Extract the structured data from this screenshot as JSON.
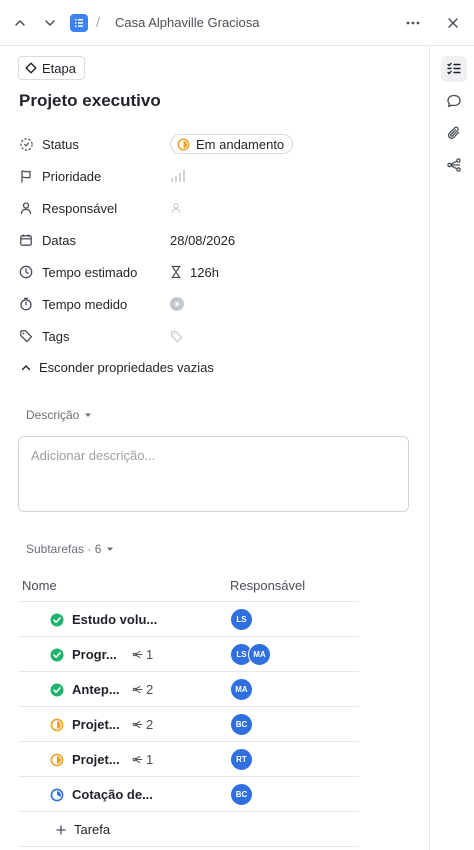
{
  "header": {
    "breadcrumb": "Casa Alphaville Graciosa",
    "separator": "/"
  },
  "task": {
    "type_badge": "Etapa",
    "title": "Projeto executivo"
  },
  "properties": [
    {
      "label": "Status",
      "value": "Em andamento"
    },
    {
      "label": "Prioridade",
      "value": ""
    },
    {
      "label": "Responsável",
      "value": ""
    },
    {
      "label": "Datas",
      "value": "28/08/2026"
    },
    {
      "label": "Tempo estimado",
      "value": "126h"
    },
    {
      "label": "Tempo medido",
      "value": ""
    },
    {
      "label": "Tags",
      "value": ""
    }
  ],
  "hide_empty_label": "Esconder propriedades vazias",
  "description": {
    "label": "Descrição",
    "placeholder": "Adicionar descrição..."
  },
  "subtasks": {
    "label": "Subtarefas · 6",
    "columns": {
      "name": "Nome",
      "assignee": "Responsável"
    },
    "rows": [
      {
        "name": "Estudo volu...",
        "count": "",
        "status": "done",
        "assignees": [
          "LS"
        ]
      },
      {
        "name": "Progr...",
        "count": "1",
        "status": "done",
        "assignees": [
          "LS",
          "MA"
        ]
      },
      {
        "name": "Antep...",
        "count": "2",
        "status": "done",
        "assignees": [
          "MA"
        ]
      },
      {
        "name": "Projet...",
        "count": "2",
        "status": "in-progress",
        "assignees": [
          "BC"
        ]
      },
      {
        "name": "Projet...",
        "count": "1",
        "status": "in-progress",
        "assignees": [
          "RT"
        ]
      },
      {
        "name": "Cotação de...",
        "count": "",
        "status": "started",
        "assignees": [
          "BC"
        ]
      }
    ],
    "add_label": "Tarefa"
  },
  "colors": {
    "accent": "#3b82f6",
    "done": "#1fb36b",
    "in_progress": "#f0a020",
    "started": "#2f6fe0",
    "avatar": "#2f6fe0"
  }
}
